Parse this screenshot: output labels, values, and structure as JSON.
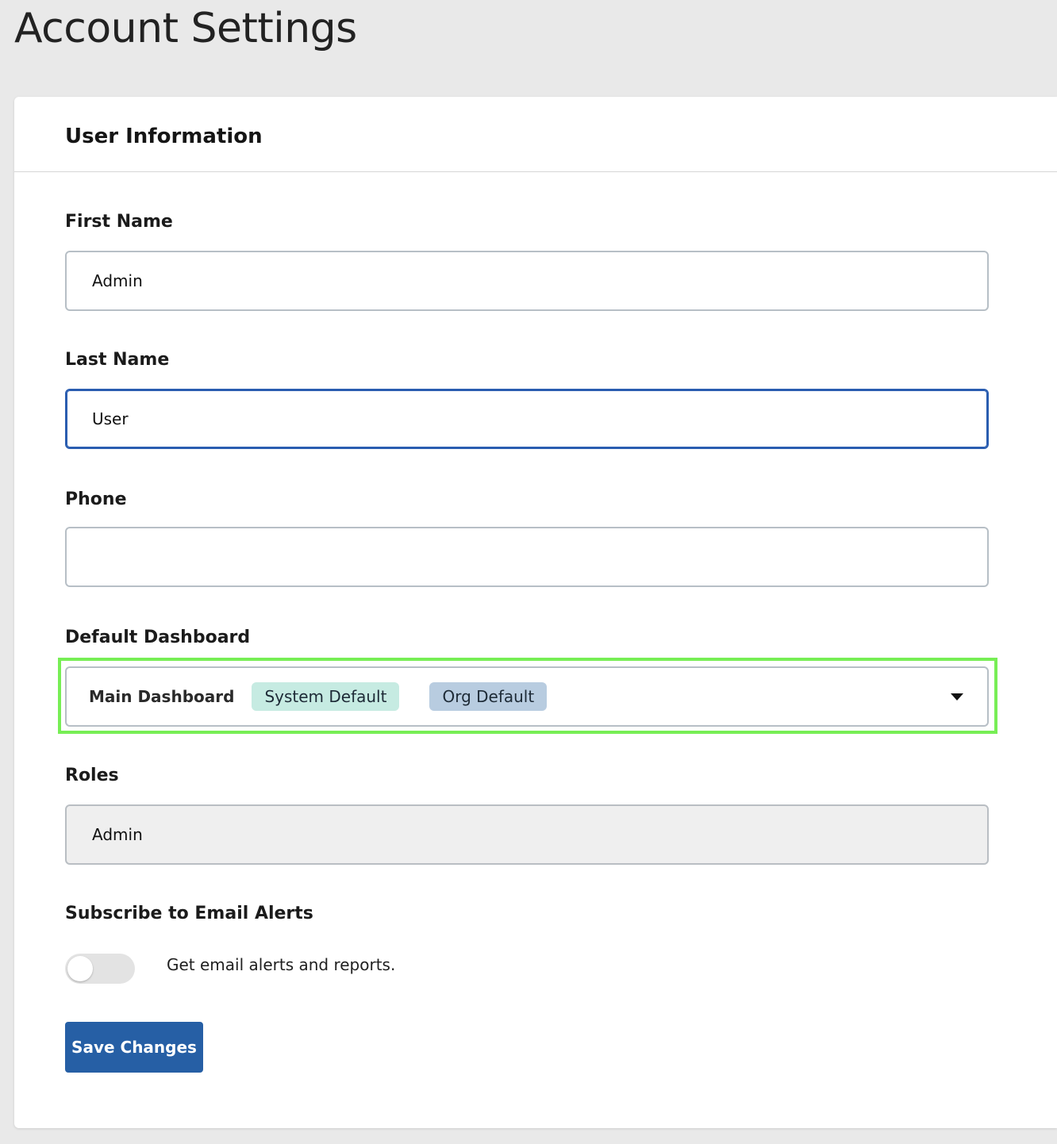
{
  "page": {
    "title": "Account Settings"
  },
  "card": {
    "title": "User Information"
  },
  "fields": {
    "first_name": {
      "label": "First Name",
      "value": "Admin"
    },
    "last_name": {
      "label": "Last Name",
      "value": "User"
    },
    "phone": {
      "label": "Phone",
      "value": ""
    },
    "default_dashboard": {
      "label": "Default Dashboard",
      "selected": "Main Dashboard",
      "tags": [
        "System Default",
        "Org Default"
      ]
    },
    "roles": {
      "label": "Roles",
      "value": "Admin"
    },
    "email_alerts": {
      "label": "Subscribe to Email Alerts",
      "toggle_text": "Get email alerts and reports.",
      "enabled": false
    }
  },
  "actions": {
    "save_label": "Save Changes"
  },
  "colors": {
    "background": "#e9e9e9",
    "primary_button": "#265fa5",
    "focus_border": "#2a5db0",
    "highlight_frame": "#77ee55",
    "tag_system": "#c6ebe2",
    "tag_org": "#b8cce0"
  }
}
